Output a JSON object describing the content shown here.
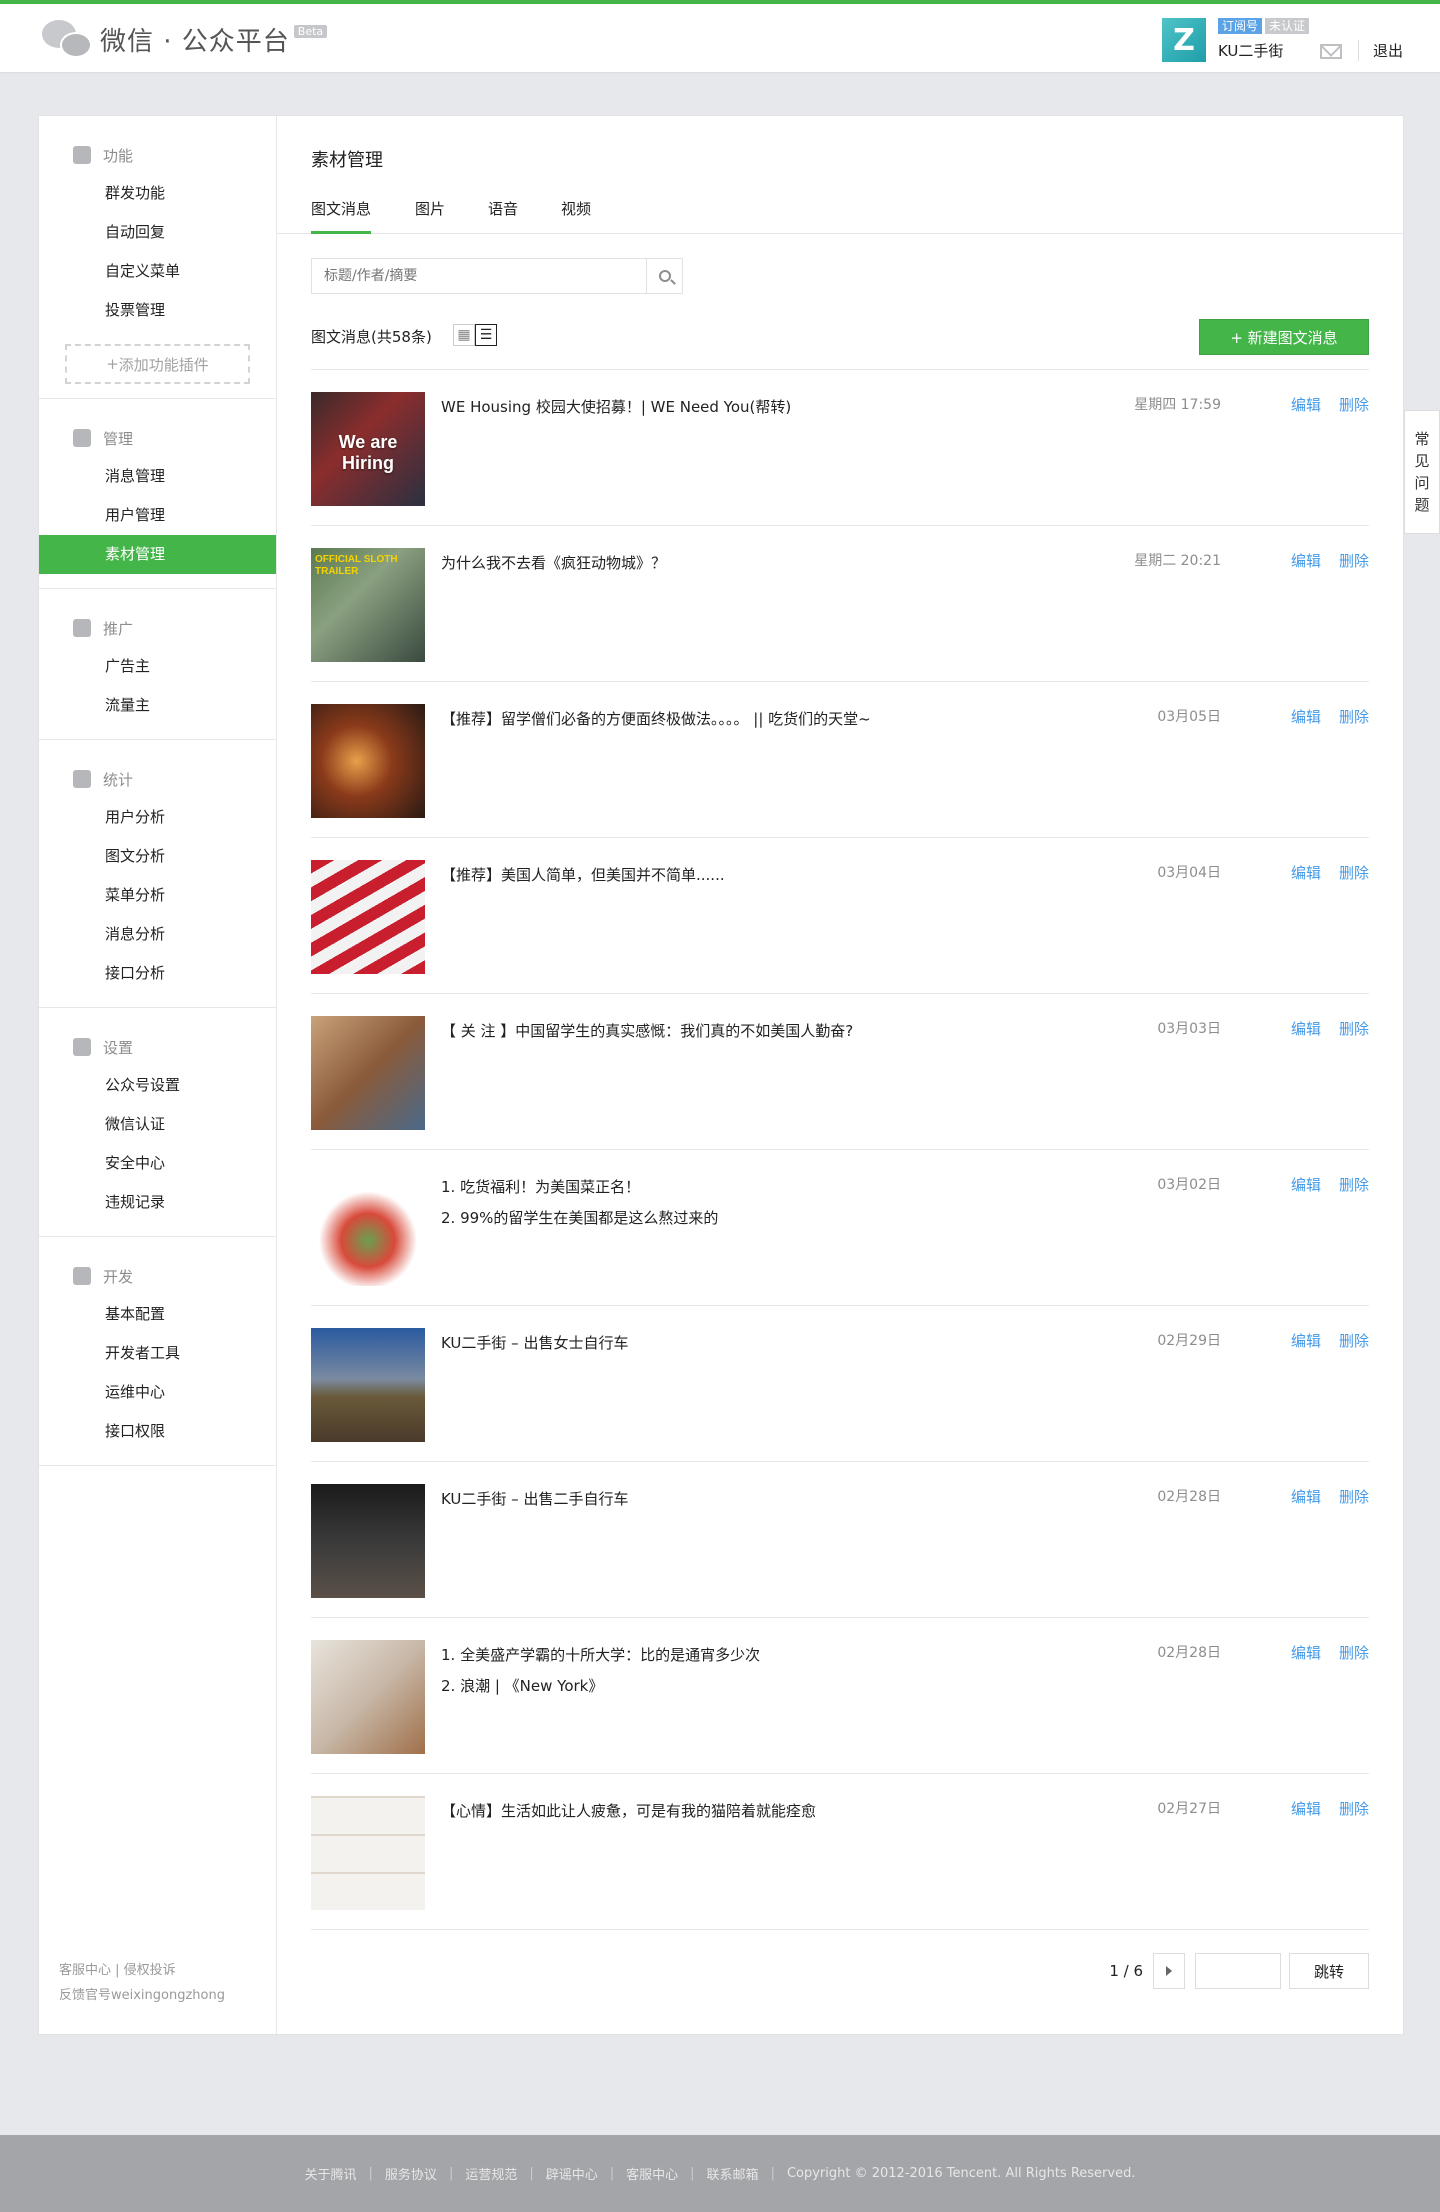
{
  "header": {
    "logo_text": "微信 · 公众平台",
    "beta": "Beta",
    "account_tag_type": "订阅号",
    "account_tag_status": "未认证",
    "account_name": "KU二手街",
    "avatar_letter": "Z",
    "logout": "退出"
  },
  "sidebar": {
    "sections": [
      {
        "head": "功能",
        "icon": "grid-icon",
        "items": [
          "群发功能",
          "自动回复",
          "自定义菜单",
          "投票管理"
        ]
      },
      {
        "head": "管理",
        "icon": "inbox-icon",
        "items": [
          "消息管理",
          "用户管理",
          "素材管理"
        ]
      },
      {
        "head": "推广",
        "icon": "megaphone-icon",
        "items": [
          "广告主",
          "流量主"
        ]
      },
      {
        "head": "统计",
        "icon": "pie-chart-icon",
        "items": [
          "用户分析",
          "图文分析",
          "菜单分析",
          "消息分析",
          "接口分析"
        ]
      },
      {
        "head": "设置",
        "icon": "gear-icon",
        "items": [
          "公众号设置",
          "微信认证",
          "安全中心",
          "违规记录"
        ]
      },
      {
        "head": "开发",
        "icon": "code-icon",
        "items": [
          "基本配置",
          "开发者工具",
          "运维中心",
          "接口权限"
        ]
      }
    ],
    "active_item": "素材管理",
    "add_plugin": "添加功能插件",
    "foot_line1": "客服中心 | 侵权投诉",
    "foot_line2": "反馈官号weixingongzhong"
  },
  "main": {
    "title": "素材管理",
    "tabs": [
      "图文消息",
      "图片",
      "语音",
      "视频"
    ],
    "search_placeholder": "标题/作者/摘要",
    "list_count": "图文消息(共58条)",
    "new_button": "+ 新建图文消息",
    "edit_label": "编辑",
    "delete_label": "删除",
    "rows": [
      {
        "titles": [
          "WE Housing 校园大使招募！| WE Need You(帮转)"
        ],
        "date": "星期四 17:59",
        "thumb": "We are Hiring",
        "bg": "linear-gradient(135deg,#3a2a2a,#8b2d2d 40%,#2a3040)"
      },
      {
        "titles": [
          "为什么我不去看《疯狂动物城》？"
        ],
        "date": "星期二 20:21",
        "thumb": "OFFICIAL SLOTH TRAILER",
        "bg": "linear-gradient(135deg,#5a7a50,#8aa080 40%,#3a4a40)"
      },
      {
        "titles": [
          "【推荐】留学僧们必备的方便面终极做法。。。。 || 吃货们的天堂~"
        ],
        "date": "03月05日",
        "thumb": "",
        "bg": "radial-gradient(circle at 40% 50%,#e8a04a,#8a3a1a 40%,#2a1a14)"
      },
      {
        "titles": [
          "【推荐】美国人简单，但美国并不简单......"
        ],
        "date": "03月04日",
        "thumb": "",
        "bg": "repeating-linear-gradient(-30deg,#c81e2e 0 12px,#f2f2f2 12px 24px)"
      },
      {
        "titles": [
          "【 关 注 】中国留学生的真实感慨：我们真的不如美国人勤奋?"
        ],
        "date": "03月03日",
        "thumb": "",
        "bg": "linear-gradient(135deg,#c9a27a,#8a5a3a 50%,#4a6a8a)"
      },
      {
        "titles": [
          "1. 吃货福利！为美国菜正名！",
          "2. 99%的留学生在美国都是这么熬过来的"
        ],
        "date": "03月02日",
        "thumb": "",
        "bg": "radial-gradient(circle at 50% 60%,#6aa050,#d84a3a 30%,#ffffff 55%)"
      },
      {
        "titles": [
          "KU二手街 – 出售女士自行车"
        ],
        "date": "02月29日",
        "thumb": "",
        "bg": "linear-gradient(180deg,#2a5aa0,#7a8aa0 45%,#6a5a3a 60%,#4a3a2a)"
      },
      {
        "titles": [
          "KU二手街 – 出售二手自行车"
        ],
        "date": "02月28日",
        "thumb": "",
        "bg": "linear-gradient(180deg,#1a1a1a,#3a3a3a 50%,#5a5048)"
      },
      {
        "titles": [
          "1. 全美盛产学霸的十所大学：比的是通宵多少次",
          "2. 浪潮 | 《New York》"
        ],
        "date": "02月28日",
        "thumb": "",
        "bg": "linear-gradient(135deg,#e8e4dc,#c8b8a8 50%,#a0704a)"
      },
      {
        "titles": [
          "【心情】生活如此让人疲惫，可是有我的猫陪着就能痊愈"
        ],
        "date": "02月27日",
        "thumb": "",
        "bg": "repeating-linear-gradient(0deg,#f4f2ee 0 36px,#e0d8cc 36px 38px)"
      }
    ],
    "pager_text": "1 / 6",
    "pager_go": "跳转"
  },
  "faq": [
    "常",
    "见",
    "问",
    "题"
  ],
  "footer": [
    "关于腾讯",
    "服务协议",
    "运营规范",
    "辟谣中心",
    "客服中心",
    "联系邮箱",
    "Copyright © 2012-2016 Tencent. All Rights Reserved."
  ],
  "colors": {
    "accent": "#44b549",
    "link": "#459ae9"
  }
}
